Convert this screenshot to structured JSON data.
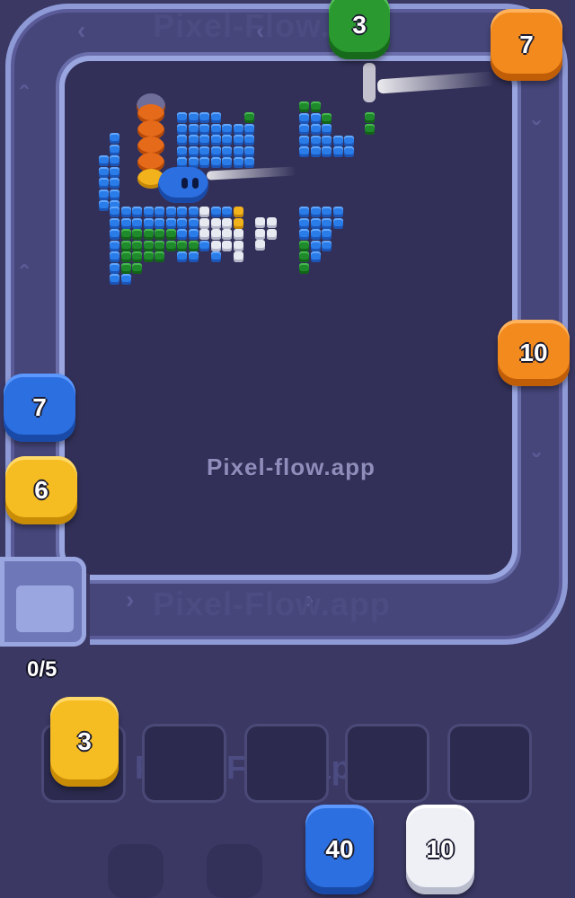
{
  "watermark": {
    "center": "Pixel-flow.app",
    "track_bottom": "Pixel-Flow.app",
    "track_top": "Pixel-Flow.app",
    "slots": "Pixel-Flow.app"
  },
  "queue_counter": "0/5",
  "shooters_on_track": [
    {
      "id": "green-top",
      "color": "green",
      "count": "3"
    },
    {
      "id": "orange-top-right",
      "color": "orange",
      "count": "7"
    },
    {
      "id": "orange-right",
      "color": "orange",
      "count": "10"
    },
    {
      "id": "blue-left",
      "color": "blue",
      "count": "7"
    },
    {
      "id": "yellow-left",
      "color": "yellow",
      "count": "6"
    }
  ],
  "holding_slots": [
    {
      "index": 1,
      "occupied_by": "yellow",
      "count": "3"
    },
    {
      "index": 2,
      "occupied_by": ""
    },
    {
      "index": 3,
      "occupied_by": ""
    },
    {
      "index": 4,
      "occupied_by": ""
    },
    {
      "index": 5,
      "occupied_by": ""
    }
  ],
  "reserve_shooters": [
    {
      "color": "blue",
      "count": "40"
    },
    {
      "color": "white",
      "count": "10"
    }
  ],
  "colors": {
    "background": "#3b3964",
    "board": "#323058",
    "track_rail": "#9aa6e0",
    "blue": "#2a7ce8",
    "green": "#1f8a2c",
    "white": "#e8eaf2",
    "yellow": "#f2b21c",
    "orange": "#f28a1e"
  }
}
